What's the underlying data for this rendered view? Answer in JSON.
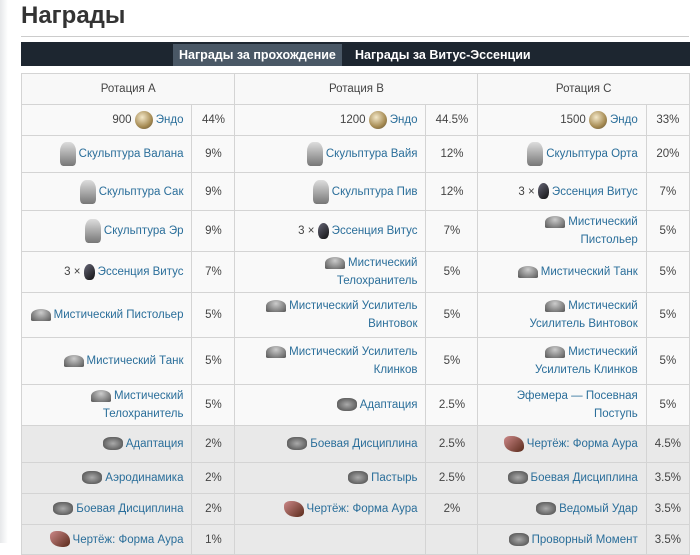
{
  "title": "Награды",
  "tabs": [
    {
      "label": "Награды за прохождение",
      "active": true
    },
    {
      "label": "Награды за Витус-Эссенции",
      "active": false
    }
  ],
  "headers": [
    "Ротация A",
    "Ротация B",
    "Ротация C"
  ],
  "rows": [
    [
      {
        "qty": "900",
        "icon": "endo",
        "name": "Эндо",
        "pct": "44%"
      },
      {
        "qty": "1200",
        "icon": "endo",
        "name": "Эндо",
        "pct": "44.5%"
      },
      {
        "qty": "1500",
        "icon": "endo",
        "name": "Эндо",
        "pct": "33%"
      }
    ],
    [
      {
        "icon": "sculpture",
        "name": "Скульптура Валана",
        "pct": "9%"
      },
      {
        "icon": "sculpture",
        "name": "Скульптура Вайя",
        "pct": "12%"
      },
      {
        "icon": "sculpture",
        "name": "Скульптура Орта",
        "pct": "20%"
      }
    ],
    [
      {
        "icon": "sculpture",
        "name": "Скульптура Сак",
        "pct": "9%"
      },
      {
        "icon": "sculpture",
        "name": "Скульптура Пив",
        "pct": "12%"
      },
      {
        "qty": "3 ×",
        "icon": "essence",
        "name": "Эссенция Витус",
        "pct": "7%"
      }
    ],
    [
      {
        "icon": "sculpture",
        "name": "Скульптура Эр",
        "pct": "9%"
      },
      {
        "qty": "3 ×",
        "icon": "essence",
        "name": "Эссенция Витус",
        "pct": "7%"
      },
      {
        "icon": "companion",
        "name": "Мистический Пистольер",
        "pct": "5%"
      }
    ],
    [
      {
        "qty": "3 ×",
        "icon": "essence",
        "name": "Эссенция Витус",
        "pct": "7%"
      },
      {
        "icon": "companion",
        "name": "Мистический Телохранитель",
        "pct": "5%"
      },
      {
        "icon": "companion",
        "name": "Мистический Танк",
        "pct": "5%"
      }
    ],
    [
      {
        "icon": "companion",
        "name": "Мистический Пистольер",
        "pct": "5%"
      },
      {
        "icon": "companion",
        "name": "Мистический Усилитель Винтовок",
        "pct": "5%"
      },
      {
        "icon": "companion",
        "name": "Мистический Усилитель Винтовок",
        "pct": "5%"
      }
    ],
    [
      {
        "icon": "companion",
        "name": "Мистический Танк",
        "pct": "5%"
      },
      {
        "icon": "companion",
        "name": "Мистический Усилитель Клинков",
        "pct": "5%"
      },
      {
        "icon": "companion",
        "name": "Мистический Усилитель Клинков",
        "pct": "5%"
      }
    ],
    [
      {
        "icon": "companion",
        "name": "Мистический Телохранитель",
        "pct": "5%"
      },
      {
        "icon": "mod",
        "name": "Адаптация",
        "pct": "2.5%"
      },
      {
        "name": "Эфемера — Посевная Поступь",
        "pct": "5%"
      }
    ],
    [
      {
        "icon": "mod",
        "name": "Адаптация",
        "pct": "2%"
      },
      {
        "icon": "mod",
        "name": "Боевая Дисциплина",
        "pct": "2.5%"
      },
      {
        "icon": "blueprint",
        "name": "Чертёж: Форма Аура",
        "pct": "4.5%"
      }
    ],
    [
      {
        "icon": "mod",
        "name": "Аэродинамика",
        "pct": "2%"
      },
      {
        "icon": "mod",
        "name": "Пастырь",
        "pct": "2.5%"
      },
      {
        "icon": "mod",
        "name": "Боевая Дисциплина",
        "pct": "3.5%"
      }
    ],
    [
      {
        "icon": "mod",
        "name": "Боевая Дисциплина",
        "pct": "2%"
      },
      {
        "icon": "blueprint",
        "name": "Чертёж: Форма Аура",
        "pct": "2%"
      },
      {
        "icon": "mod",
        "name": "Ведомый Удар",
        "pct": "3.5%"
      }
    ],
    [
      {
        "icon": "blueprint",
        "name": "Чертёж: Форма Аура",
        "pct": "1%"
      },
      {},
      {
        "icon": "mod",
        "name": "Проворный Момент",
        "pct": "3.5%"
      }
    ]
  ]
}
